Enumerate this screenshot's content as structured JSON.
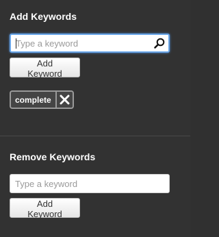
{
  "add_section": {
    "title": "Add Keywords",
    "input_placeholder": "Type a keyword",
    "button_label": "Add Keyword",
    "tags": [
      {
        "label": "complete"
      }
    ]
  },
  "remove_section": {
    "title": "Remove Keywords",
    "input_placeholder": "Type a keyword",
    "button_label": "Add Keyword"
  },
  "icons": {
    "search": "search-icon",
    "tag_remove": "close-icon"
  },
  "colors": {
    "background": "#323232",
    "focus_ring": "#6aa6e8",
    "tag_border": "#9a9a9a"
  }
}
